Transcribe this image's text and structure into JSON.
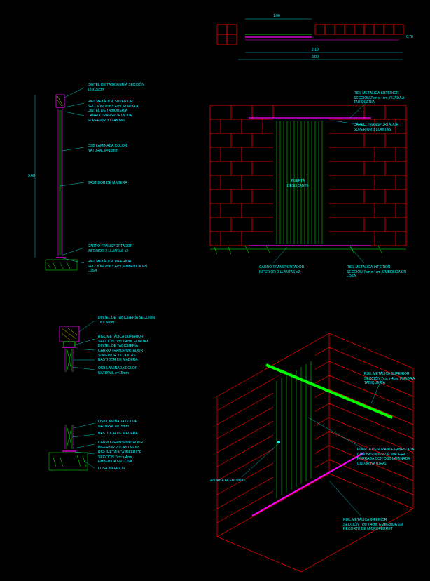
{
  "diagram_type": "CAD architectural door detail drawings",
  "colors": {
    "brick": "#ff0000",
    "door": "#00ff00",
    "metal": "#ff00ff",
    "text": "#00ffff",
    "hatch": "#ffff00"
  },
  "plan": {
    "dim1": "1.00",
    "dim2": "0.70",
    "dim3": "2.10",
    "dim4": "3.80"
  },
  "section_full": {
    "height_dim": "3.60",
    "l1": "DINTEL DE TABIQUERÍA SECCIÓN\n18 x 30cm",
    "l2": "RIEL METÁLICA SUPERIOR\nSECCIÓN 7cm x 4cm, FIJADA A\nDINTEL DE TABIQUERÍA",
    "l3": "CARRO TRANSPORTADOR\nSUPERIOR 3 LLANTAS",
    "l4": "OSB LAMINADA COLOR\nNATURAL e=15mm",
    "l5": "BASTIDOR DE MADERA",
    "l6": "CARRO TRANSPORTADOR\nINFERIOR 2 LLANTAS x2",
    "l7": "RIEL METÁLICA INFERIOR\nSECCIÓN 7cm x 4cm, EMBEBIDA EN\nLOSA"
  },
  "elevation": {
    "l1": "RIEL METÁLICA SUPERIOR\nSECCIÓN 7cm x 4cm, FIJADA A\nTABIQUERÍA",
    "l2": "CARRO TRANSPORTADOR\nSUPERIOR 3 LLANTAS",
    "center": "PUERTA\nDESLIZANTE",
    "l3": "CARRO TRANSPORTADOR\nINFERIOR 2 LLANTAS x2",
    "l4": "RIEL METÁLICA INFERIOR\nSECCIÓN 7cm x 4cm, EMBEBIDA EN\nLOSA"
  },
  "detail_top": {
    "l1": "DINTEL DE TABIQUERÍA SECCIÓN\n18 x 30cm",
    "l2": "RIEL METÁLICA SUPERIOR\nSECCIÓN 7cm x 4cm, FIJADA A\nDINTEL DE TABIQUERÍA",
    "l3": "CARRO TRANSPORTADOR\nSUPERIOR 3 LLANTAS",
    "l4": "BASTIDOR DE MADERA",
    "l5": "OSB LAMINADA COLOR\nNATURAL e=15mm"
  },
  "detail_bottom": {
    "l1": "OSB LAMINADA COLOR\nNATURAL e=15mm",
    "l2": "BASTIDOR DE MADERA",
    "l3": "CARRO TRANSPORTADOR\nINFERIOR 2 LLANTAS x2",
    "l4": "RIEL METÁLICA INFERIOR\nSECCIÓN 7cm x 4cm,\nEMBEBIDA EN LOSA",
    "l5": "LOSA INFERIOR"
  },
  "isometric": {
    "l1": "RIEL METÁLICA SUPERIOR\nSECCIÓN 7cm x 4cm, FIJADA A\nTABIQUERÍA",
    "l2": "ALDABA ACEROINOX",
    "l3": "PUERTA DESLIZANTE FABRICADA\nCON BASTIDOR DE MADERA\nFORRADA CON OSB LAMINADA\nCOLOR NATURAL",
    "l4": "RIEL METÁLICA INFERIOR\nSECCIÓN 7cm x 4cm, EMBEBIDA EN\nRECORTE DE MICROFERRET"
  }
}
